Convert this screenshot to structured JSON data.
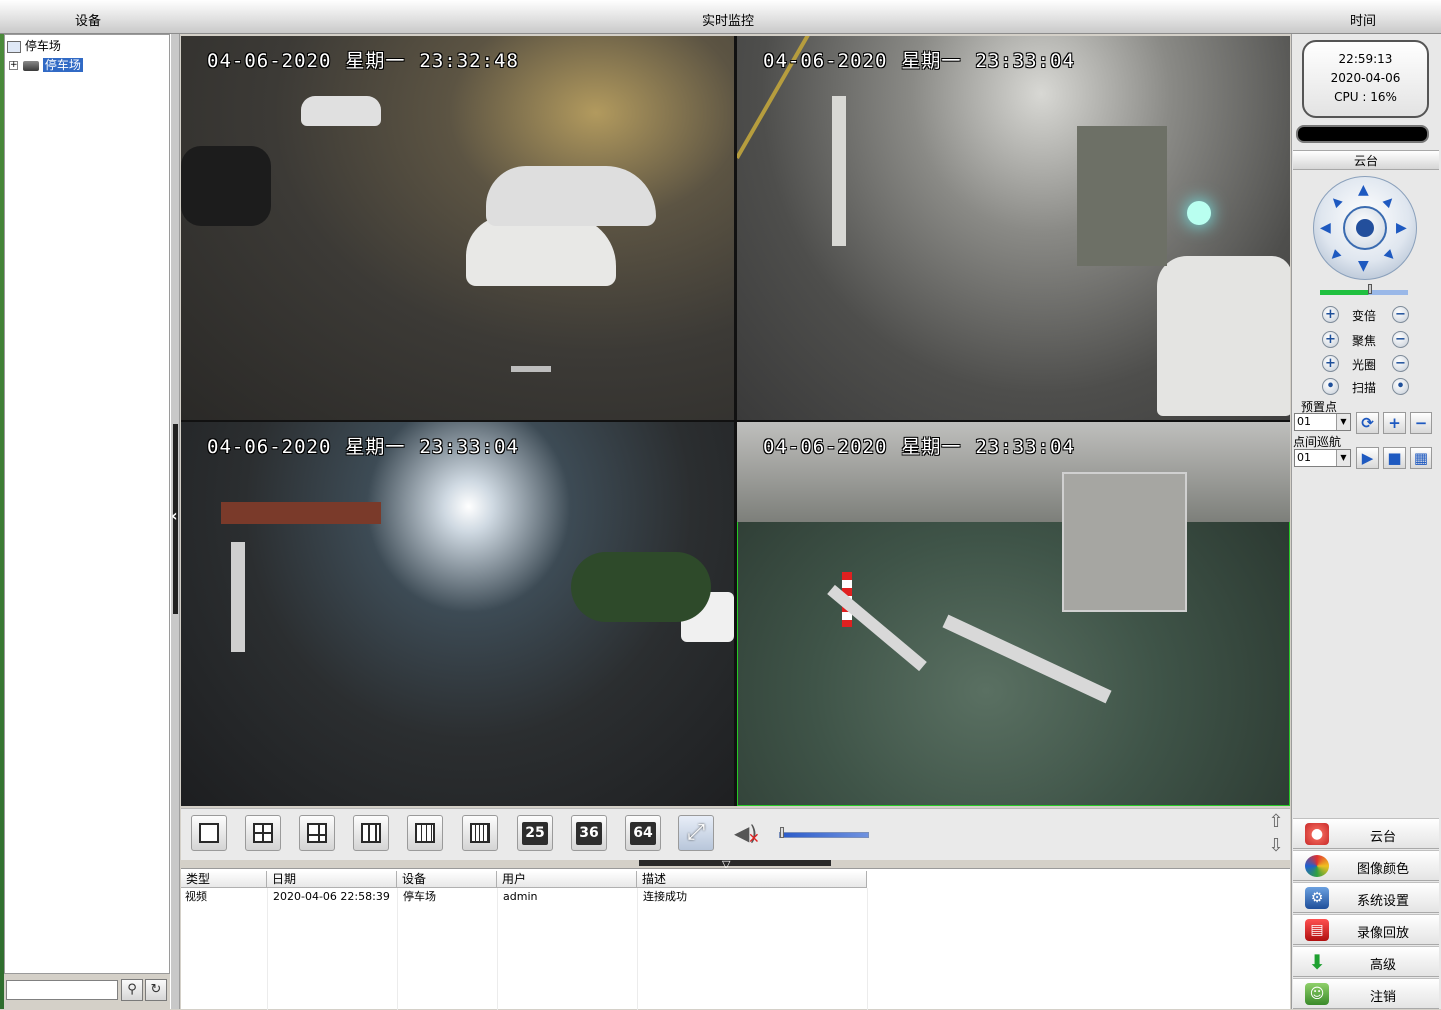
{
  "header": {
    "device_label": "设备",
    "monitor_label": "实时监控",
    "time_label": "时间"
  },
  "tree": {
    "root_label": "停车场",
    "child_label": "停车场",
    "child_expander": "+"
  },
  "search": {
    "value": "",
    "search_icon": "search-icon",
    "refresh_icon": "refresh-icon"
  },
  "cameras": [
    {
      "date": "04-06-2020",
      "weekday": "星期一",
      "time": "23:32:48",
      "active": false
    },
    {
      "date": "04-06-2020",
      "weekday": "星期一",
      "time": "23:33:04",
      "active": false
    },
    {
      "date": "04-06-2020",
      "weekday": "星期一",
      "time": "23:33:04",
      "active": false
    },
    {
      "date": "04-06-2020",
      "weekday": "星期一",
      "time": "23:33:04",
      "active": true
    }
  ],
  "clock": {
    "time": "22:59:13",
    "date": "2020-04-06",
    "cpu": "CPU : 16%"
  },
  "ptz": {
    "title": "云台",
    "zoom": "变倍",
    "focus": "聚焦",
    "iris": "光圈",
    "scan": "扫描",
    "preset_label": "预置点",
    "preset_value": "01",
    "cruise_label": "点间巡航",
    "cruise_value": "01"
  },
  "menu": {
    "ptz": "云台",
    "image_color": "图像颜色",
    "system_settings": "系统设置",
    "playback": "录像回放",
    "advanced": "高级",
    "logout": "注销"
  },
  "toolbar": {
    "layout_25": "25",
    "layout_36": "36",
    "layout_64": "64",
    "volume_level": 0.0
  },
  "log": {
    "headers": [
      "类型",
      "日期",
      "设备",
      "用户",
      "描述"
    ],
    "rows": [
      [
        "视频",
        "2020-04-06 22:58:39",
        "停车场",
        "admin",
        "连接成功"
      ]
    ]
  },
  "colors": {
    "active_frame": "#25c825",
    "selection": "#316ac5",
    "ptz_blue": "#1e59c0"
  }
}
